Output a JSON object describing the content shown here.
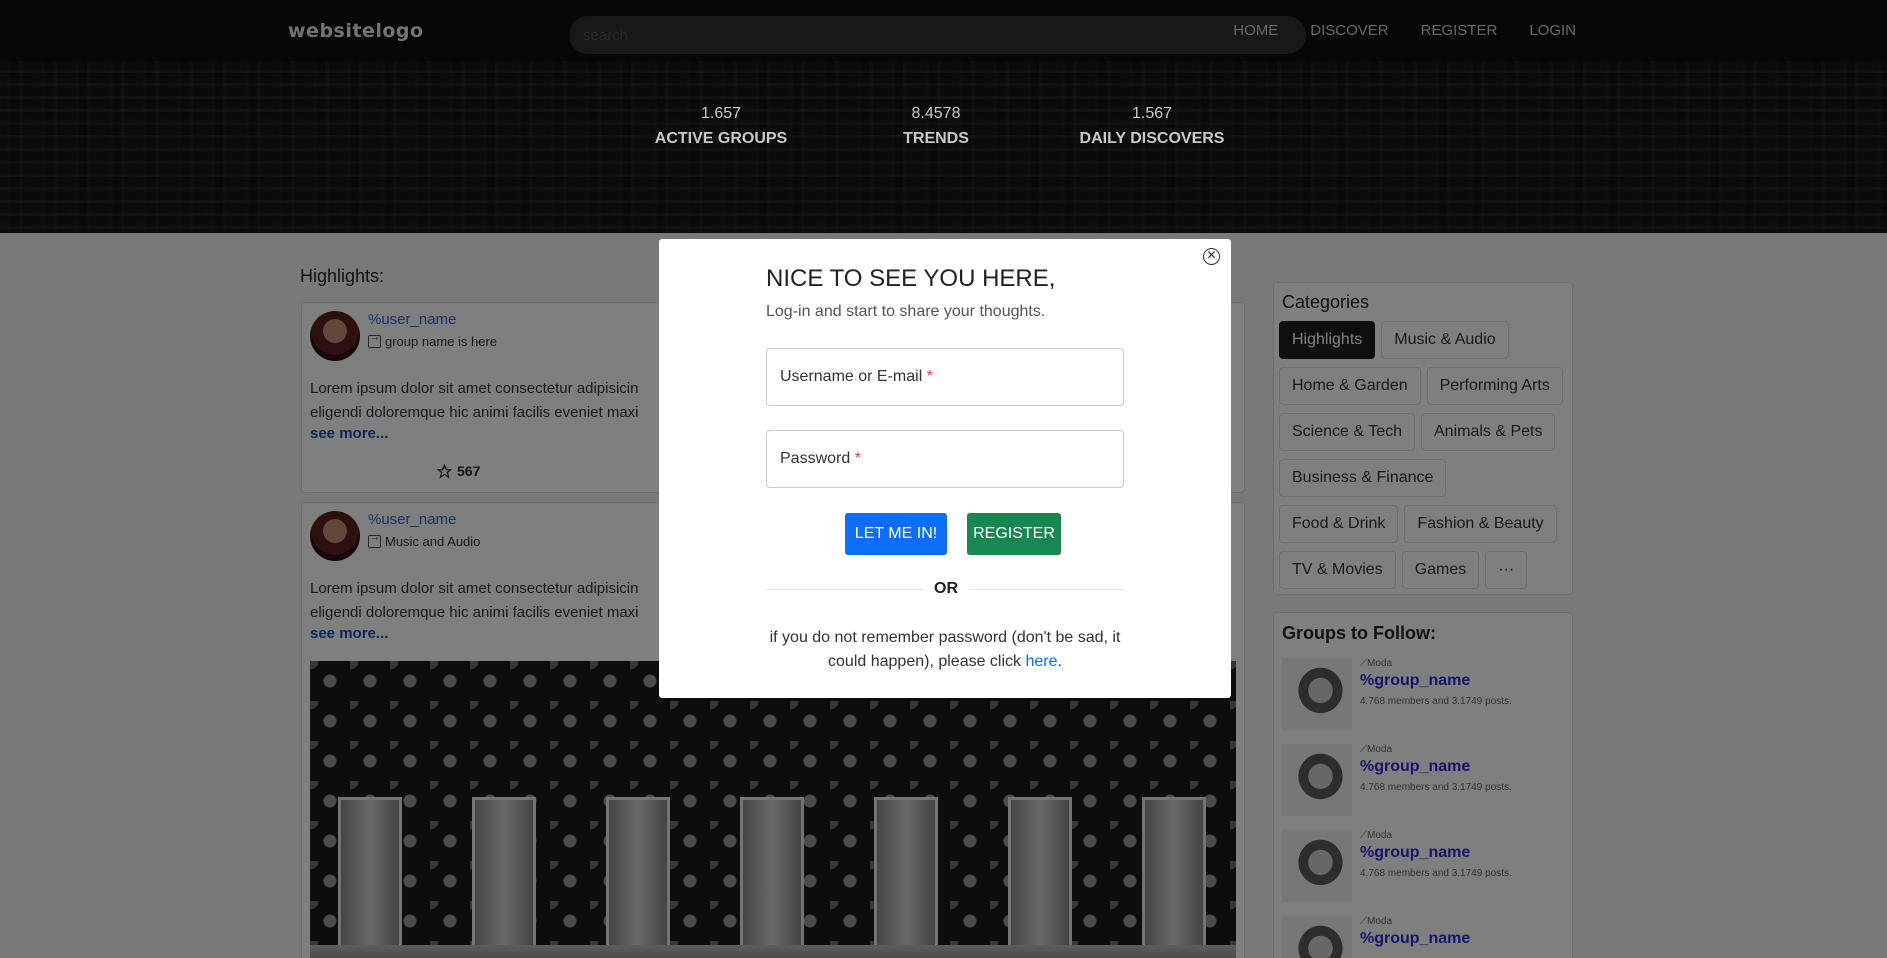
{
  "navbar": {
    "logo": "websitelogo",
    "search_placeholder": "search",
    "links": [
      "HOME",
      "DISCOVER",
      "REGISTER",
      "LOGIN"
    ]
  },
  "stats": [
    {
      "value": "1.657",
      "label": "ACTIVE GROUPS"
    },
    {
      "value": "8.4578",
      "label": "TRENDS"
    },
    {
      "value": "1.567",
      "label": "DAILY DISCOVERS"
    }
  ],
  "feed": {
    "title": "Highlights:",
    "posts": [
      {
        "username": "%user_name",
        "group": "group name is here",
        "text_line1": "Lorem ipsum dolor sit amet consectetur adipisicin",
        "text_line2": "eligendi doloremque hic animi facilis eveniet maxi",
        "see_more": "see more...",
        "stars": "567"
      },
      {
        "username": "%user_name",
        "group": "Music and Audio",
        "text_line1": "Lorem ipsum dolor sit amet consectetur adipisicin",
        "text_line2": "eligendi doloremque hic animi facilis eveniet maxi",
        "see_more": "see more..."
      }
    ]
  },
  "categories": {
    "title": "Categories",
    "items": [
      "Highlights",
      "Music & Audio",
      "Home & Garden",
      "Performing Arts",
      "Science & Tech",
      "Animals & Pets",
      "Business & Finance",
      "Food & Drink",
      "Fashion & Beauty",
      "TV & Movies",
      "Games",
      "···"
    ],
    "active": "Highlights"
  },
  "groups": {
    "title": "Groups to Follow:",
    "items": [
      {
        "tag": "Moda",
        "name": "%group_name",
        "meta": "4.768 members and 3.1749 posts."
      },
      {
        "tag": "Moda",
        "name": "%group_name",
        "meta": "4.768 members and 3.1749 posts."
      },
      {
        "tag": "Moda",
        "name": "%group_name",
        "meta": "4.768 members and 3.1749 posts."
      },
      {
        "tag": "Moda",
        "name": "%group_name",
        "meta": ""
      }
    ]
  },
  "modal": {
    "title": "NICE TO SEE YOU HERE,",
    "subtitle": "Log-in and start to share your thoughts.",
    "username_label": "Username or E-mail",
    "password_label": "Password",
    "required_mark": "*",
    "login_button": "LET ME IN!",
    "register_button": "REGISTER",
    "or": "OR",
    "forgot_prefix": "if you do not remember password (don't be sad, it could happen), please click ",
    "forgot_link": "here",
    "forgot_suffix": "."
  },
  "colors": {
    "primary": "#0d6efd",
    "success": "#198754",
    "link": "#3366cc",
    "group_link": "#2a2ad6",
    "required": "#dc3545"
  }
}
